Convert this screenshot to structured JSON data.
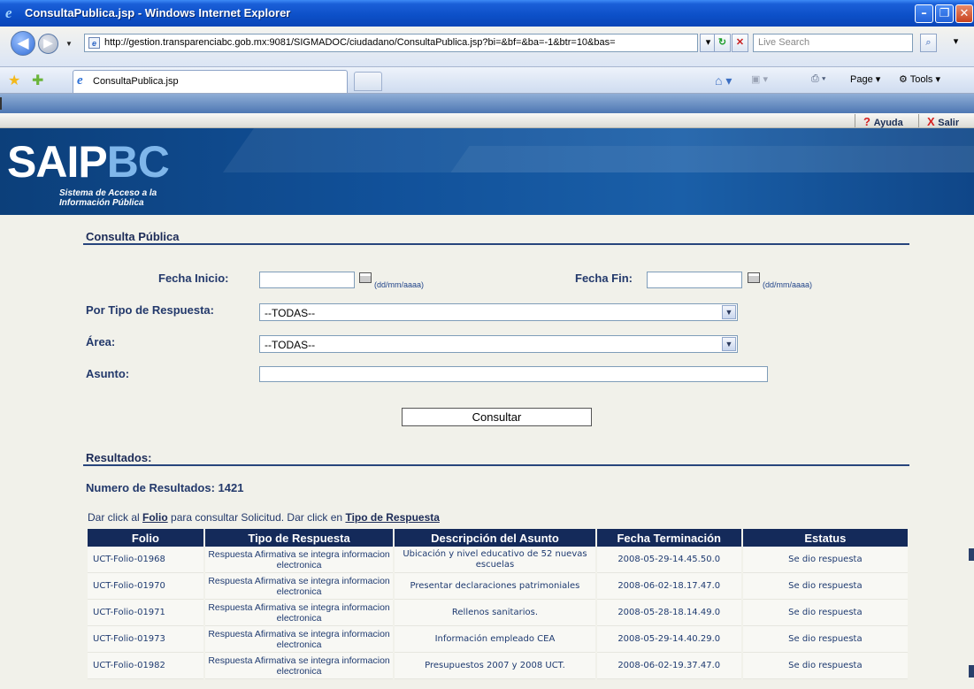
{
  "window": {
    "title": "ConsultaPublica.jsp - Windows Internet Explorer",
    "minimize": "–",
    "maximize": "❐",
    "close": "✕"
  },
  "address_bar": {
    "url": "http://gestion.transparenciabc.gob.mx:9081/SIGMADOC/ciudadano/ConsultaPublica.jsp?bi=&bf=&ba=-1&btr=10&bas=",
    "search_placeholder": "Live Search"
  },
  "tab": {
    "label": "ConsultaPublica.jsp"
  },
  "command_bar": {
    "page": "Page ▾",
    "tools": "Tools ▾"
  },
  "header_links": {
    "help": "Ayuda",
    "exit": "Salir"
  },
  "logo": {
    "text_a": "SAIP",
    "text_b": "BC",
    "subtitle_line1": "Sistema de Acceso a la",
    "subtitle_line2": "Información Pública"
  },
  "consulta": {
    "title": "Consulta Pública",
    "fecha_inicio_label": "Fecha Inicio:",
    "fecha_fin_label": "Fecha Fin:",
    "date_hint": "(dd/mm/aaaa)",
    "tipo_label": "Por Tipo de Respuesta:",
    "tipo_value": "--TODAS--",
    "area_label": "Área:",
    "area_value": "--TODAS--",
    "asunto_label": "Asunto:",
    "submit_label": "Consultar"
  },
  "resultados": {
    "title": "Resultados:",
    "count_text": "Numero de Resultados: 1421",
    "instr_1": "Dar click al ",
    "instr_folio": "Folio",
    "instr_2": " para consultar Solicitud. Dar click en ",
    "instr_tipo": "Tipo de Respuesta",
    "columns": [
      "Folio",
      "Tipo de Respuesta",
      "Descripción del Asunto",
      "Fecha Terminación",
      "Estatus"
    ],
    "rows": [
      {
        "folio": "UCT-Folio-01968",
        "tipo": "Respuesta Afirmativa se integra informacion electronica",
        "desc": "Ubicación y nivel educativo de 52 nuevas escuelas",
        "fecha": "2008-05-29-14.45.50.0",
        "estatus": "Se dio respuesta"
      },
      {
        "folio": "UCT-Folio-01970",
        "tipo": "Respuesta Afirmativa se integra informacion electronica",
        "desc": "Presentar declaraciones patrimoniales",
        "fecha": "2008-06-02-18.17.47.0",
        "estatus": "Se dio respuesta"
      },
      {
        "folio": "UCT-Folio-01971",
        "tipo": "Respuesta Afirmativa se integra informacion electronica",
        "desc": "Rellenos sanitarios.",
        "fecha": "2008-05-28-18.14.49.0",
        "estatus": "Se dio respuesta"
      },
      {
        "folio": "UCT-Folio-01973",
        "tipo": "Respuesta Afirmativa se integra informacion electronica",
        "desc": "Información empleado CEA",
        "fecha": "2008-05-29-14.40.29.0",
        "estatus": "Se dio respuesta"
      },
      {
        "folio": "UCT-Folio-01982",
        "tipo": "Respuesta Afirmativa se integra informacion electronica",
        "desc": "Presupuestos 2007 y 2008 UCT.",
        "fecha": "2008-06-02-19.37.47.0",
        "estatus": "Se dio respuesta"
      }
    ]
  },
  "colors": {
    "navy": "#142a5a",
    "label_blue": "#23396b",
    "banner": "#11519a",
    "titlebar": "#0c4fc7"
  }
}
